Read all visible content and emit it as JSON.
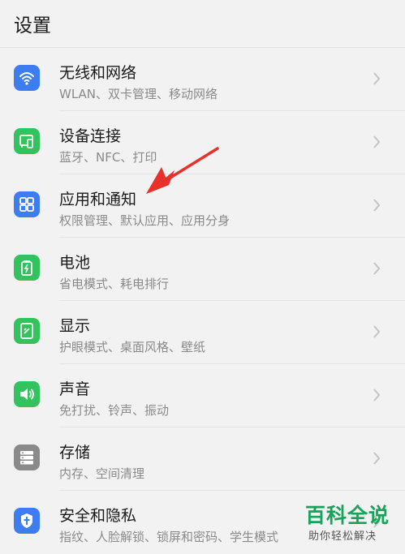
{
  "header": {
    "title": "设置"
  },
  "items": [
    {
      "label": "无线和网络",
      "sub": "WLAN、双卡管理、移动网络",
      "icon": "wifi-icon",
      "color": "#3d7df0"
    },
    {
      "label": "设备连接",
      "sub": "蓝牙、NFC、打印",
      "icon": "device-connection-icon",
      "color": "#34c25f"
    },
    {
      "label": "应用和通知",
      "sub": "权限管理、默认应用、应用分身",
      "icon": "apps-grid-icon",
      "color": "#3d7df0"
    },
    {
      "label": "电池",
      "sub": "省电模式、耗电排行",
      "icon": "battery-icon",
      "color": "#34c25f"
    },
    {
      "label": "显示",
      "sub": "护眼模式、桌面风格、壁纸",
      "icon": "display-icon",
      "color": "#34c25f"
    },
    {
      "label": "声音",
      "sub": "免打扰、铃声、振动",
      "icon": "speaker-icon",
      "color": "#34c25f"
    },
    {
      "label": "存储",
      "sub": "内存、空间清理",
      "icon": "storage-icon",
      "color": "#8a8a8a"
    },
    {
      "label": "安全和隐私",
      "sub": "指纹、人脸解锁、锁屏和密码、学生模式",
      "icon": "shield-icon",
      "color": "#3d7df0"
    }
  ],
  "watermark": {
    "title": "百科全说",
    "sub": "助你轻松解决"
  },
  "annotation": {
    "arrow_color": "#e8312a",
    "points_to": "应用和通知"
  }
}
